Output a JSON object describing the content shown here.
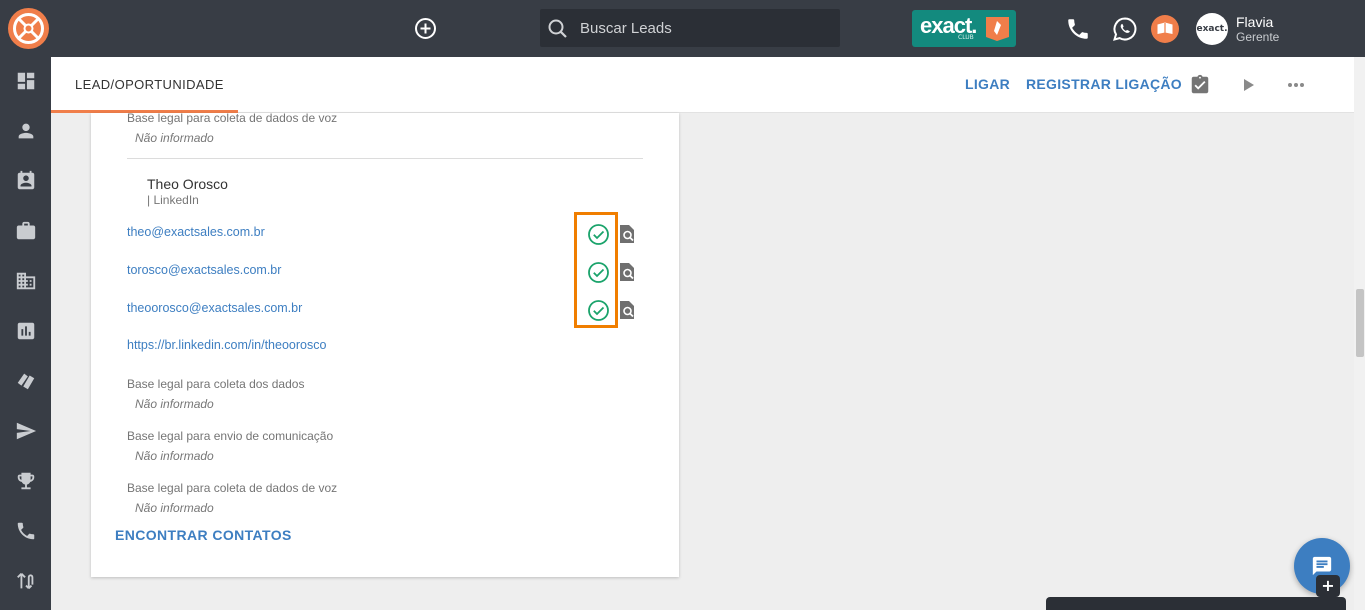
{
  "topbar": {
    "search_placeholder": "Buscar Leads",
    "club": {
      "word": "exact.",
      "sub": "CLUB"
    },
    "user": {
      "name": "Flavia",
      "role": "Gerente",
      "avatar_label": "exact."
    }
  },
  "sidebar": {
    "items": [
      {
        "icon": "dashboard-icon"
      },
      {
        "icon": "person-icon"
      },
      {
        "icon": "contact-calendar-icon"
      },
      {
        "icon": "briefcase-icon"
      },
      {
        "icon": "building-icon"
      },
      {
        "icon": "bar-chart-icon"
      },
      {
        "icon": "tags-icon"
      },
      {
        "icon": "send-icon"
      },
      {
        "icon": "trophy-icon"
      },
      {
        "icon": "phone-icon"
      },
      {
        "icon": "swap-icon"
      }
    ]
  },
  "header": {
    "tab_label": "LEAD/OPORTUNIDADE",
    "call_label": "LIGAR",
    "register_call_label": "REGISTRAR LIGAÇÃO"
  },
  "card": {
    "top_field": {
      "label": "Base legal para coleta de dados de voz",
      "value": "Não informado"
    },
    "contact": {
      "name": "Theo Orosco",
      "source": "| LinkedIn",
      "emails": [
        "theo@exactsales.com.br",
        "torosco@exactsales.com.br",
        "theoorosco@exactsales.com.br"
      ],
      "linkedin_url": "https://br.linkedin.com/in/theoorosco"
    },
    "legal_fields": [
      {
        "label": "Base legal para coleta dos dados",
        "value": "Não informado"
      },
      {
        "label": "Base legal para envio de comunicação",
        "value": "Não informado"
      },
      {
        "label": "Base legal para coleta de dados de voz",
        "value": "Não informado"
      }
    ],
    "find_contacts_label": "ENCONTRAR CONTATOS"
  },
  "fab": {
    "plus_label": "+"
  },
  "colors": {
    "topbar_bg": "#383d45",
    "accent_orange": "#f07e4a",
    "link_blue": "#3d7ec1",
    "check_green": "#1aa36b",
    "highlight_orange": "#f07e00",
    "club_teal": "#138a7e"
  }
}
